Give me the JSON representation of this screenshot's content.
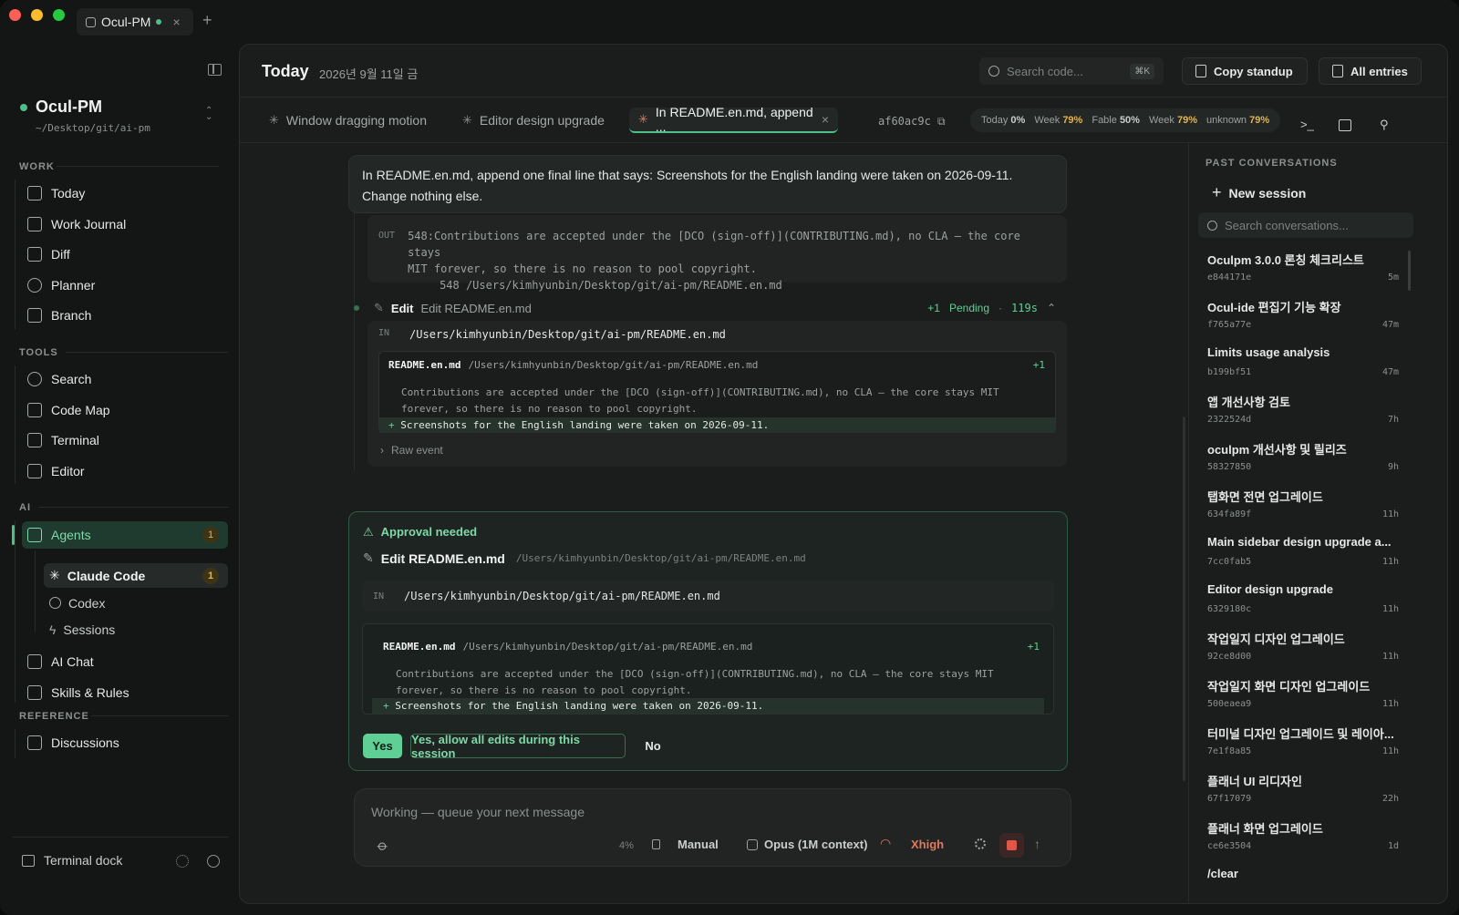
{
  "window": {
    "tab_label": "Ocul-PM",
    "new_tab": "+",
    "close": "×"
  },
  "workspace": {
    "name": "Ocul-PM",
    "path": "~/Desktop/git/ai-pm"
  },
  "sidebar": {
    "work_title": "WORK",
    "work": [
      {
        "label": "Today",
        "icon": "upload-icon"
      },
      {
        "label": "Work Journal",
        "icon": "notebook-icon"
      },
      {
        "label": "Diff",
        "icon": "diff-icon"
      },
      {
        "label": "Planner",
        "icon": "target-icon"
      },
      {
        "label": "Branch",
        "icon": "git-branch-icon"
      }
    ],
    "tools_title": "TOOLS",
    "tools": [
      {
        "label": "Search",
        "icon": "search-icon"
      },
      {
        "label": "Code Map",
        "icon": "sitemap-icon"
      },
      {
        "label": "Terminal",
        "icon": "terminal-icon"
      },
      {
        "label": "Editor",
        "icon": "file-code-icon"
      }
    ],
    "ai_title": "AI",
    "agents": {
      "label": "Agents",
      "badge": "1"
    },
    "agent_subs": [
      {
        "label": "Claude Code",
        "badge": "1"
      },
      {
        "label": "Codex"
      },
      {
        "label": "Sessions"
      }
    ],
    "ai_more": [
      {
        "label": "AI Chat",
        "icon": "chat-icon"
      },
      {
        "label": "Skills & Rules",
        "icon": "puzzle-icon"
      }
    ],
    "reference_title": "REFERENCE",
    "reference": [
      {
        "label": "Discussions",
        "icon": "discussion-icon"
      }
    ],
    "dock_label": "Terminal dock"
  },
  "header": {
    "title": "Today",
    "date": "2026년 9월 11일 금",
    "search_placeholder": "Search code...",
    "search_shortcut": "⌘K",
    "copy_standup": "Copy standup",
    "all_entries": "All entries"
  },
  "tabs": [
    {
      "label": "Window dragging motion"
    },
    {
      "label": "Editor design upgrade"
    },
    {
      "label": "In README.en.md, append ..."
    }
  ],
  "commit_hash": "af60ac9c",
  "usage": [
    {
      "label": "Today",
      "value": "0%"
    },
    {
      "label": "Week",
      "value": "79%"
    },
    {
      "label": "Fable",
      "value": "50%"
    },
    {
      "label": "Week",
      "value": "79%"
    },
    {
      "label": "unknown",
      "value": "79%"
    }
  ],
  "chat": {
    "user_message": "In README.en.md, append one final line that says: Screenshots for the English landing were taken on 2026-09-11. Change nothing else.",
    "out_label": "OUT",
    "out_lines": [
      "548:Contributions are accepted under the [DCO (sign-off)](CONTRIBUTING.md), no CLA — the core stays",
      "MIT forever, so there is no reason to pool copyright.",
      "    548 /Users/kimhyunbin/Desktop/git/ai-pm/README.en.md"
    ],
    "edit_tool": {
      "verb": "Edit",
      "target": "Edit README.en.md",
      "delta": "+1",
      "status": "Pending",
      "sep": "·",
      "duration": "119s",
      "in_label": "IN",
      "in_path": "/Users/kimhyunbin/Desktop/git/ai-pm/README.en.md",
      "file": "README.en.md",
      "file_path": "/Users/kimhyunbin/Desktop/git/ai-pm/README.en.md",
      "file_delta": "+1",
      "ctx1": "Contributions are accepted under the [DCO (sign-off)](CONTRIBUTING.md), no CLA — the core stays MIT",
      "ctx2": "forever, so there is no reason to pool copyright.",
      "added_marker": "+",
      "added": "Screenshots for the English landing were taken on 2026-09-11.",
      "raw_event": "Raw event"
    },
    "approval": {
      "title": "Approval needed",
      "edit_title": "Edit README.en.md",
      "edit_path": "/Users/kimhyunbin/Desktop/git/ai-pm/README.en.md",
      "in_label": "IN",
      "in_path": "/Users/kimhyunbin/Desktop/git/ai-pm/README.en.md",
      "file": "README.en.md",
      "file_path": "/Users/kimhyunbin/Desktop/git/ai-pm/README.en.md",
      "file_delta": "+1",
      "ctx1": "Contributions are accepted under the [DCO (sign-off)](CONTRIBUTING.md), no CLA — the core stays MIT",
      "ctx2": "forever, so there is no reason to pool copyright.",
      "added_marker": "+",
      "added": "Screenshots for the English landing were taken on 2026-09-11.",
      "yes": "Yes",
      "yes_all": "Yes, allow all edits during this session",
      "no": "No"
    },
    "composer": {
      "placeholder": "Working — queue your next message",
      "context_pct": "4%",
      "mode": "Manual",
      "model": "Opus (1M context)",
      "effort": "Xhigh"
    }
  },
  "past": {
    "title": "PAST CONVERSATIONS",
    "new_session": "New session",
    "search_placeholder": "Search conversations...",
    "items": [
      {
        "title": "Oculpm 3.0.0 론칭 체크리스트",
        "hash": "e844171e",
        "age": "5m"
      },
      {
        "title": "Ocul-ide 편집기 기능 확장",
        "hash": "f765a77e",
        "age": "47m"
      },
      {
        "title": "Limits usage analysis",
        "hash": "b199bf51",
        "age": "47m"
      },
      {
        "title": "앱 개선사항 검토",
        "hash": "2322524d",
        "age": "7h"
      },
      {
        "title": "oculpm 개선사항 및 릴리즈",
        "hash": "58327850",
        "age": "9h"
      },
      {
        "title": "탭화면 전면 업그레이드",
        "hash": "634fa89f",
        "age": "11h"
      },
      {
        "title": "Main sidebar design upgrade a...",
        "hash": "7cc0fab5",
        "age": "11h"
      },
      {
        "title": "Editor design upgrade",
        "hash": "6329180c",
        "age": "11h"
      },
      {
        "title": "작업일지 디자인 업그레이드",
        "hash": "92ce8d00",
        "age": "11h"
      },
      {
        "title": "작업일지 화면 디자인 업그레이드",
        "hash": "500eaea9",
        "age": "11h"
      },
      {
        "title": "터미널 디자인 업그레이드 및 레이아...",
        "hash": "7e1f8a85",
        "age": "11h"
      },
      {
        "title": "플래너 UI 리디자인",
        "hash": "67f17079",
        "age": "22h"
      },
      {
        "title": "플래너 화면 업그레이드",
        "hash": "ce6e3504",
        "age": "1d"
      },
      {
        "title": "/clear",
        "hash": "",
        "age": ""
      }
    ]
  }
}
